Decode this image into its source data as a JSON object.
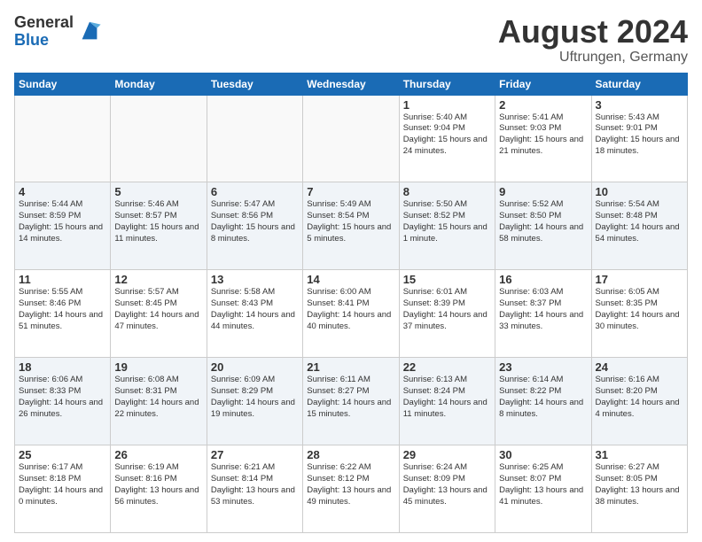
{
  "header": {
    "logo_general": "General",
    "logo_blue": "Blue",
    "month": "August 2024",
    "location": "Uftrungen, Germany"
  },
  "days_of_week": [
    "Sunday",
    "Monday",
    "Tuesday",
    "Wednesday",
    "Thursday",
    "Friday",
    "Saturday"
  ],
  "weeks": [
    [
      {
        "day": "",
        "info": ""
      },
      {
        "day": "",
        "info": ""
      },
      {
        "day": "",
        "info": ""
      },
      {
        "day": "",
        "info": ""
      },
      {
        "day": "1",
        "info": "Sunrise: 5:40 AM\nSunset: 9:04 PM\nDaylight: 15 hours and 24 minutes."
      },
      {
        "day": "2",
        "info": "Sunrise: 5:41 AM\nSunset: 9:03 PM\nDaylight: 15 hours and 21 minutes."
      },
      {
        "day": "3",
        "info": "Sunrise: 5:43 AM\nSunset: 9:01 PM\nDaylight: 15 hours and 18 minutes."
      }
    ],
    [
      {
        "day": "4",
        "info": "Sunrise: 5:44 AM\nSunset: 8:59 PM\nDaylight: 15 hours and 14 minutes."
      },
      {
        "day": "5",
        "info": "Sunrise: 5:46 AM\nSunset: 8:57 PM\nDaylight: 15 hours and 11 minutes."
      },
      {
        "day": "6",
        "info": "Sunrise: 5:47 AM\nSunset: 8:56 PM\nDaylight: 15 hours and 8 minutes."
      },
      {
        "day": "7",
        "info": "Sunrise: 5:49 AM\nSunset: 8:54 PM\nDaylight: 15 hours and 5 minutes."
      },
      {
        "day": "8",
        "info": "Sunrise: 5:50 AM\nSunset: 8:52 PM\nDaylight: 15 hours and 1 minute."
      },
      {
        "day": "9",
        "info": "Sunrise: 5:52 AM\nSunset: 8:50 PM\nDaylight: 14 hours and 58 minutes."
      },
      {
        "day": "10",
        "info": "Sunrise: 5:54 AM\nSunset: 8:48 PM\nDaylight: 14 hours and 54 minutes."
      }
    ],
    [
      {
        "day": "11",
        "info": "Sunrise: 5:55 AM\nSunset: 8:46 PM\nDaylight: 14 hours and 51 minutes."
      },
      {
        "day": "12",
        "info": "Sunrise: 5:57 AM\nSunset: 8:45 PM\nDaylight: 14 hours and 47 minutes."
      },
      {
        "day": "13",
        "info": "Sunrise: 5:58 AM\nSunset: 8:43 PM\nDaylight: 14 hours and 44 minutes."
      },
      {
        "day": "14",
        "info": "Sunrise: 6:00 AM\nSunset: 8:41 PM\nDaylight: 14 hours and 40 minutes."
      },
      {
        "day": "15",
        "info": "Sunrise: 6:01 AM\nSunset: 8:39 PM\nDaylight: 14 hours and 37 minutes."
      },
      {
        "day": "16",
        "info": "Sunrise: 6:03 AM\nSunset: 8:37 PM\nDaylight: 14 hours and 33 minutes."
      },
      {
        "day": "17",
        "info": "Sunrise: 6:05 AM\nSunset: 8:35 PM\nDaylight: 14 hours and 30 minutes."
      }
    ],
    [
      {
        "day": "18",
        "info": "Sunrise: 6:06 AM\nSunset: 8:33 PM\nDaylight: 14 hours and 26 minutes."
      },
      {
        "day": "19",
        "info": "Sunrise: 6:08 AM\nSunset: 8:31 PM\nDaylight: 14 hours and 22 minutes."
      },
      {
        "day": "20",
        "info": "Sunrise: 6:09 AM\nSunset: 8:29 PM\nDaylight: 14 hours and 19 minutes."
      },
      {
        "day": "21",
        "info": "Sunrise: 6:11 AM\nSunset: 8:27 PM\nDaylight: 14 hours and 15 minutes."
      },
      {
        "day": "22",
        "info": "Sunrise: 6:13 AM\nSunset: 8:24 PM\nDaylight: 14 hours and 11 minutes."
      },
      {
        "day": "23",
        "info": "Sunrise: 6:14 AM\nSunset: 8:22 PM\nDaylight: 14 hours and 8 minutes."
      },
      {
        "day": "24",
        "info": "Sunrise: 6:16 AM\nSunset: 8:20 PM\nDaylight: 14 hours and 4 minutes."
      }
    ],
    [
      {
        "day": "25",
        "info": "Sunrise: 6:17 AM\nSunset: 8:18 PM\nDaylight: 14 hours and 0 minutes."
      },
      {
        "day": "26",
        "info": "Sunrise: 6:19 AM\nSunset: 8:16 PM\nDaylight: 13 hours and 56 minutes."
      },
      {
        "day": "27",
        "info": "Sunrise: 6:21 AM\nSunset: 8:14 PM\nDaylight: 13 hours and 53 minutes."
      },
      {
        "day": "28",
        "info": "Sunrise: 6:22 AM\nSunset: 8:12 PM\nDaylight: 13 hours and 49 minutes."
      },
      {
        "day": "29",
        "info": "Sunrise: 6:24 AM\nSunset: 8:09 PM\nDaylight: 13 hours and 45 minutes."
      },
      {
        "day": "30",
        "info": "Sunrise: 6:25 AM\nSunset: 8:07 PM\nDaylight: 13 hours and 41 minutes."
      },
      {
        "day": "31",
        "info": "Sunrise: 6:27 AM\nSunset: 8:05 PM\nDaylight: 13 hours and 38 minutes."
      }
    ]
  ]
}
